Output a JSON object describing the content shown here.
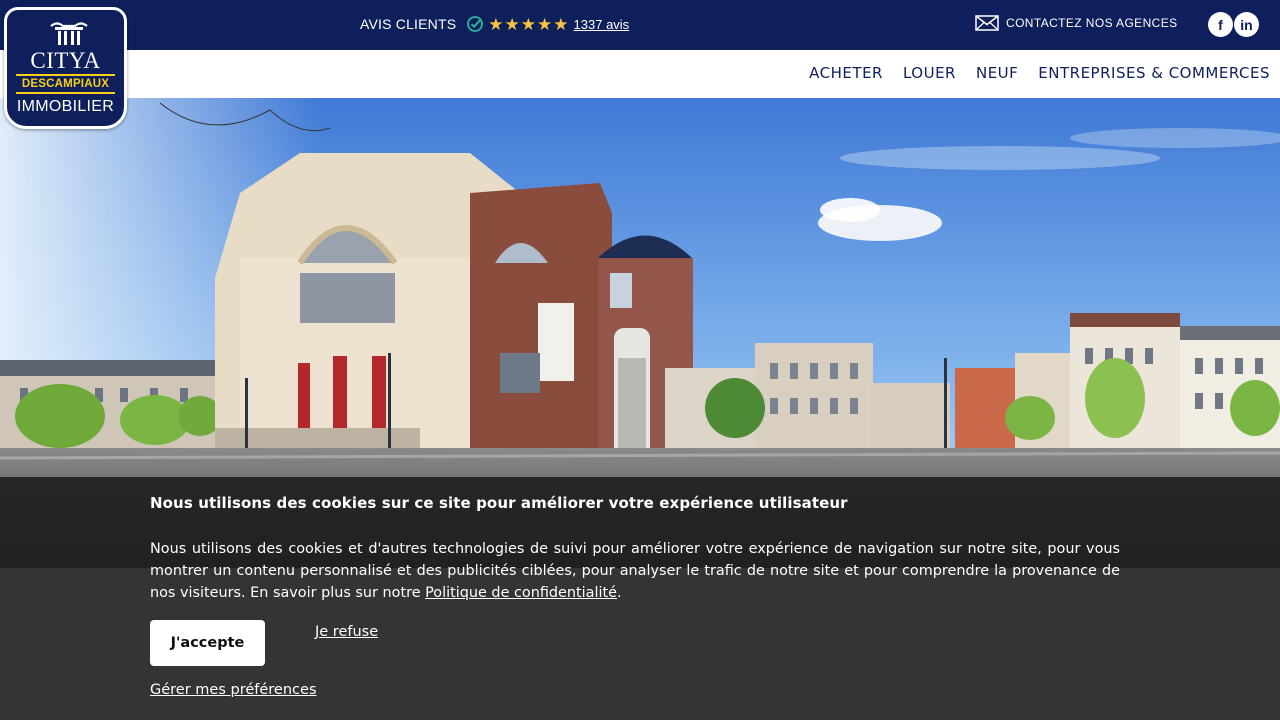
{
  "colors": {
    "brand_navy": "#0e1f5c",
    "brand_yellow": "#f7d117",
    "star": "#f6c343",
    "banner_bg": "#1e1e1e"
  },
  "topbar": {
    "reviews_label": "AVIS CLIENTS",
    "verified_icon": "verified-check-icon",
    "rating_stars": 5,
    "reviews_count": "1337 avis",
    "contact_label": "CONTACTEZ NOS AGENCES",
    "contact_icon": "envelope-icon",
    "social": [
      {
        "name": "facebook",
        "glyph": "f"
      },
      {
        "name": "linkedin",
        "glyph": "in"
      }
    ]
  },
  "logo": {
    "brand": "CITYA",
    "subtitle": "DESCAMPIAUX",
    "tagline": "IMMOBILIER"
  },
  "nav": {
    "items": [
      {
        "label": "ACHETER"
      },
      {
        "label": "LOUER"
      },
      {
        "label": "NEUF"
      },
      {
        "label": "ENTREPRISES & COMMERCES"
      }
    ]
  },
  "cookie_banner": {
    "title": "Nous utilisons des cookies sur ce site pour améliorer votre expérience utilisateur",
    "body": "Nous utilisons des cookies et d'autres technologies de suivi pour améliorer votre expérience de navigation sur notre site, pour vous montrer un contenu personnalisé et des publicités ciblées, pour analyser le trafic de notre site et pour comprendre la provenance de nos visiteurs. En savoir plus sur notre",
    "privacy_link": "Politique de confidentialité",
    "body_end": ".",
    "accept_label": "J'accepte",
    "refuse_label": "Je refuse",
    "manage_label": "Gérer mes préférences"
  }
}
